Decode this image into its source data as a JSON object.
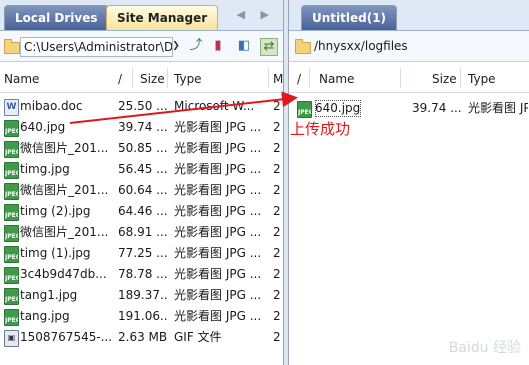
{
  "left": {
    "tabs": [
      {
        "label": "Local Drives"
      },
      {
        "label": "Site Manager"
      }
    ],
    "nav_arrows": "◀ ▶",
    "path": "C:\\Users\\Administrator\\D",
    "columns": {
      "name": "Name",
      "sort": "/",
      "size": "Size",
      "type": "Type",
      "m": "M"
    },
    "rows": [
      {
        "name": "mibao.doc",
        "size": "25.50 ...",
        "type": "Microsoft W...",
        "m": "2",
        "icon": "doc-file-icon"
      },
      {
        "name": "640.jpg",
        "size": "39.74 ...",
        "type": "光影看图 JPG ...",
        "m": "2",
        "icon": "jpeg-file-icon"
      },
      {
        "name": "微信图片_201...",
        "size": "50.85 ...",
        "type": "光影看图 JPG ...",
        "m": "2",
        "icon": "jpeg-file-icon"
      },
      {
        "name": "timg.jpg",
        "size": "56.45 ...",
        "type": "光影看图 JPG ...",
        "m": "2",
        "icon": "jpeg-file-icon"
      },
      {
        "name": "微信图片_201...",
        "size": "60.64 ...",
        "type": "光影看图 JPG ...",
        "m": "2",
        "icon": "jpeg-file-icon"
      },
      {
        "name": "timg (2).jpg",
        "size": "64.46 ...",
        "type": "光影看图 JPG ...",
        "m": "2",
        "icon": "jpeg-file-icon"
      },
      {
        "name": "微信图片_201...",
        "size": "68.91 ...",
        "type": "光影看图 JPG ...",
        "m": "2",
        "icon": "jpeg-file-icon"
      },
      {
        "name": "timg (1).jpg",
        "size": "77.25 ...",
        "type": "光影看图 JPG ...",
        "m": "2",
        "icon": "jpeg-file-icon"
      },
      {
        "name": "3c4b9d47db...",
        "size": "78.78 ...",
        "type": "光影看图 JPG ...",
        "m": "2",
        "icon": "jpeg-file-icon"
      },
      {
        "name": "tang1.jpg",
        "size": "189.37...",
        "type": "光影看图 JPG ...",
        "m": "2",
        "icon": "jpeg-file-icon"
      },
      {
        "name": "tang.jpg",
        "size": "191.06...",
        "type": "光影看图 JPG ...",
        "m": "2",
        "icon": "jpeg-file-icon"
      },
      {
        "name": "1508767545-...",
        "size": "2.63 MB",
        "type": "GIF 文件",
        "m": "2",
        "icon": "gif-file-icon"
      }
    ]
  },
  "right": {
    "tabs": [
      {
        "label": "Untitled(1)"
      }
    ],
    "path": "/hnysxx/logfiles",
    "columns": {
      "sort": "/",
      "name": "Name",
      "size": "Size",
      "type": "Type"
    },
    "rows": [
      {
        "name": "640.jpg",
        "size": "39.74 ...",
        "type": "光影看图 JPE",
        "icon": "jpeg-file-icon"
      }
    ]
  },
  "annotation": {
    "text": "上传成功",
    "color": "#e0171c"
  },
  "watermark": "Baidu 经验"
}
